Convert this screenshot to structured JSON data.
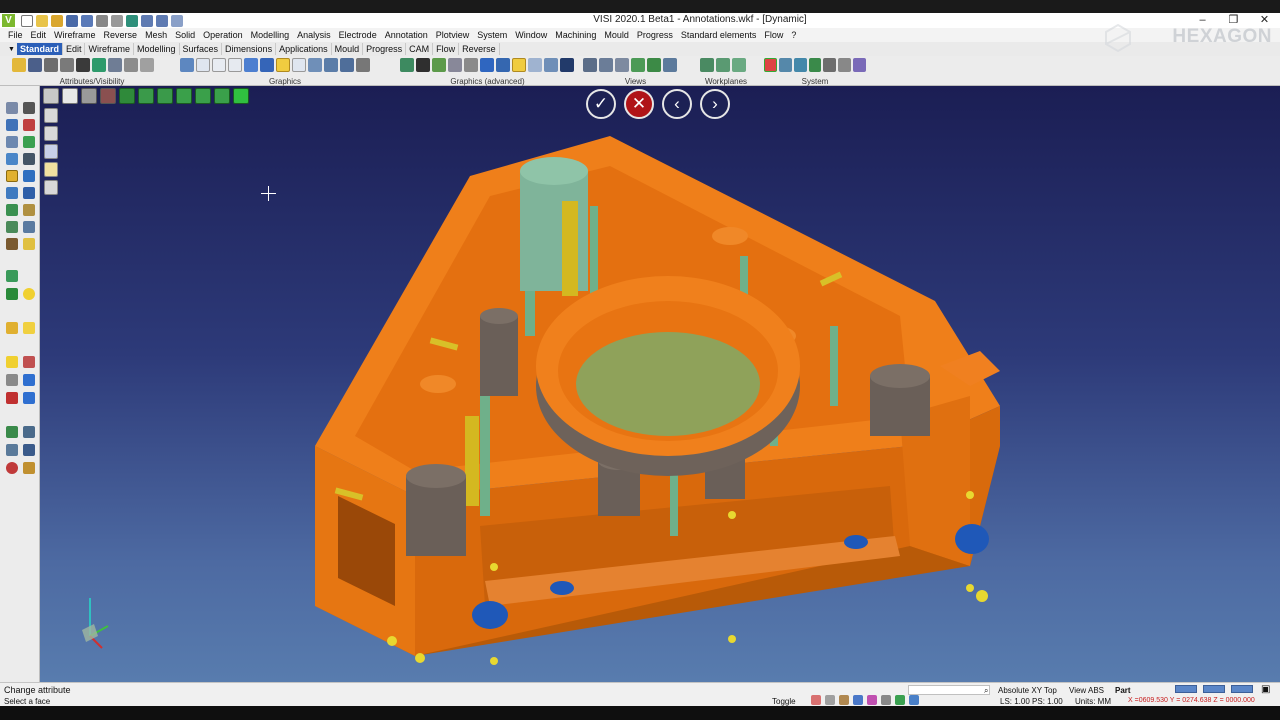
{
  "window": {
    "title": "VISI 2020.1 Beta1 - Annotations.wkf - [Dynamic]",
    "logo_letter": "V",
    "controls": [
      "–",
      "❐",
      "✕"
    ]
  },
  "menu": [
    "File",
    "Edit",
    "Wireframe",
    "Reverse",
    "Mesh",
    "Solid",
    "Operation",
    "Modelling",
    "Analysis",
    "Electrode",
    "Annotation",
    "Plotview",
    "System",
    "Window",
    "Machining",
    "Mould",
    "Progress",
    "Standard elements",
    "Flow",
    "?"
  ],
  "ribbon_tabs": [
    "Standard",
    "Edit",
    "Wireframe",
    "Modelling",
    "Surfaces",
    "Dimensions",
    "Applications",
    "Mould",
    "Progress",
    "CAM",
    "Flow",
    "Reverse"
  ],
  "ribbon_groups": {
    "attributes": "Attributes/Visibility",
    "graphics": "Graphics",
    "graphics_adv": "Graphics (advanced)",
    "views": "Views",
    "workplanes": "Workplanes",
    "system": "System"
  },
  "brand": "HEXAGON",
  "confirm": {
    "ok": "✓",
    "cancel": "✕",
    "prev": "‹",
    "next": "›"
  },
  "status": {
    "command": "Change attribute",
    "prompt": "Select a face",
    "toggle": "Toggle",
    "ls_ps": "LS: 1.00 PS: 1.00",
    "view_top": "Absolute XY Top",
    "view_abs": "View ABS",
    "part": "Part",
    "units": "Units: MM",
    "coords": "X =0609.530 Y = 0274.638 Z = 0000.000"
  },
  "colors": {
    "accent": "#2b5fb8",
    "part_orange": "#e87410",
    "cylinder_green": "#7fa888",
    "cancel_red": "#b01418"
  }
}
